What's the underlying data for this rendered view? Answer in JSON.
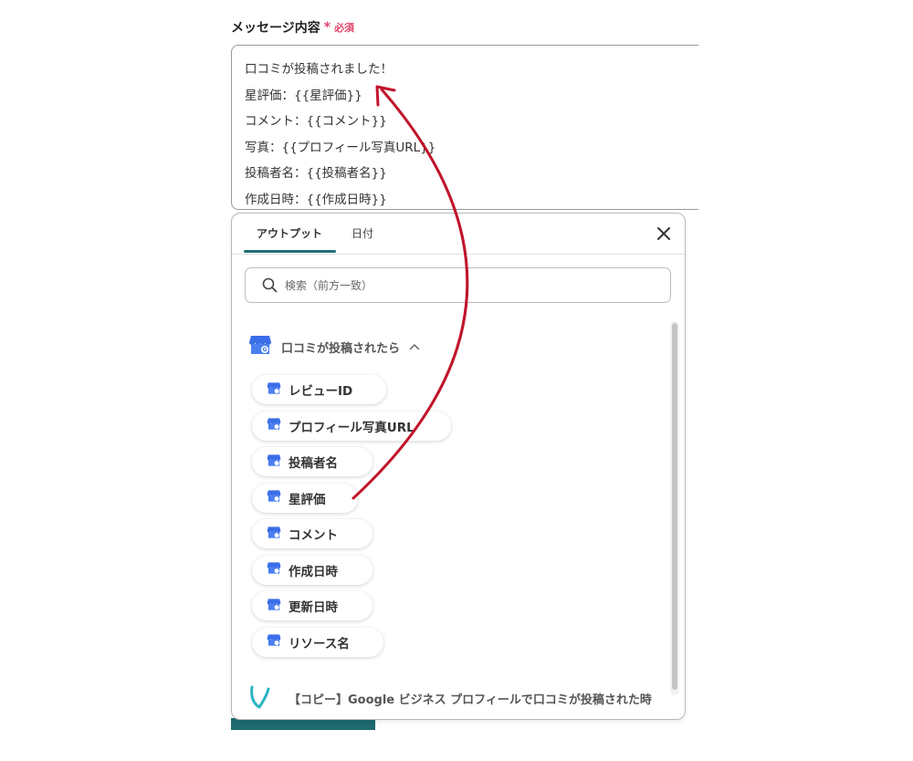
{
  "field": {
    "label": "メッセージ内容",
    "required_mark": "*",
    "required_text": "必須"
  },
  "message": {
    "lines": [
      "口コミが投稿されました！",
      "星評価：{{星評価}}",
      "コメント：{{コメント}}",
      "写真：{{プロフィール写真URL}}",
      "投稿者名：{{投稿者名}}",
      "作成日時：{{作成日時}}"
    ]
  },
  "panel": {
    "tabs": [
      "アウトプット",
      "日付"
    ],
    "active_tab": 0,
    "search_placeholder": "検索（前方一致）",
    "section_title": "口コミが投稿されたら",
    "items": [
      "レビューID",
      "プロフィール写真URL",
      "投稿者名",
      "星評価",
      "コメント",
      "作成日時",
      "更新日時",
      "リソース名"
    ],
    "footer_text": "【コピー】Google ビジネス プロフィールで口コミが投稿された時"
  },
  "icons": {
    "item_icon": "google-business-profile-icon",
    "footer_icon": "yoom-logo-icon",
    "close": "close-icon",
    "search": "search-icon",
    "collapse": "chevron-up-icon"
  },
  "colors": {
    "accent": "#1f6f76",
    "required": "#e0456a",
    "arrow": "#c0142a",
    "google_blue": "#3a6ee8",
    "yoom_teal": "#2bb5c2"
  }
}
